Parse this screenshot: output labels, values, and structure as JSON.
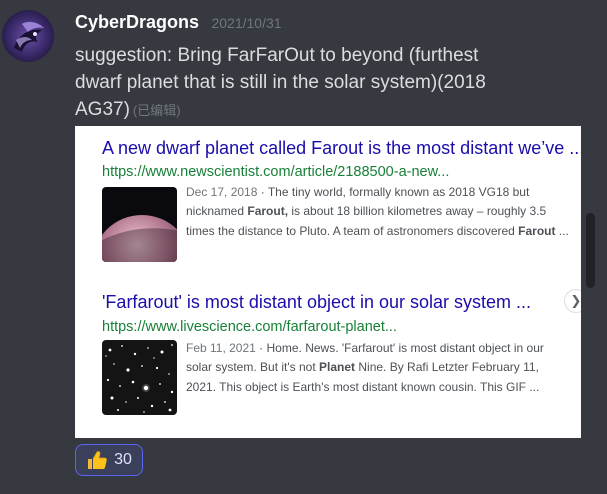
{
  "message": {
    "username": "CyberDragons",
    "timestamp": "2021/10/31",
    "text": "suggestion: Bring FarFarOut to beyond (furthest dwarf planet that is still in the solar system)(2018 AG37)",
    "edited": "(已编辑)"
  },
  "embed": {
    "results": [
      {
        "title": "A new dwarf planet called Farout is the most distant we’ve ...",
        "url": "https://www.newscientist.com/article/2188500-a-new...",
        "date": "Dec 17, 2018",
        "snippet_lines": [
          [
            "The tiny world, formally known as 2018 VG18 but"
          ],
          [
            "nicknamed ",
            "Farout,",
            " is about 18 billion kilometres away – roughly 3.5"
          ],
          [
            "times the distance to Pluto. A team of astronomers discovered ",
            "Farout",
            " ..."
          ]
        ]
      },
      {
        "title": "'Farfarout' is most distant object in our solar system ...",
        "url": "https://www.livescience.com/farfarout-planet...",
        "date": "Feb 11, 2021",
        "snippet_lines": [
          [
            "Home. News. 'Farfarout' is most distant object in our"
          ],
          [
            "solar system. But it's not ",
            "Planet",
            " Nine. By Rafi Letzter February 11,"
          ],
          [
            "2021. This object is Earth's most distant known cousin. This GIF ..."
          ]
        ]
      }
    ]
  },
  "reaction": {
    "emoji": "thumbs-up",
    "count": "30"
  },
  "colors": {
    "background": "#36393f",
    "link": "#1a0dab",
    "url": "#188038",
    "reaction_border": "#5865f2"
  }
}
